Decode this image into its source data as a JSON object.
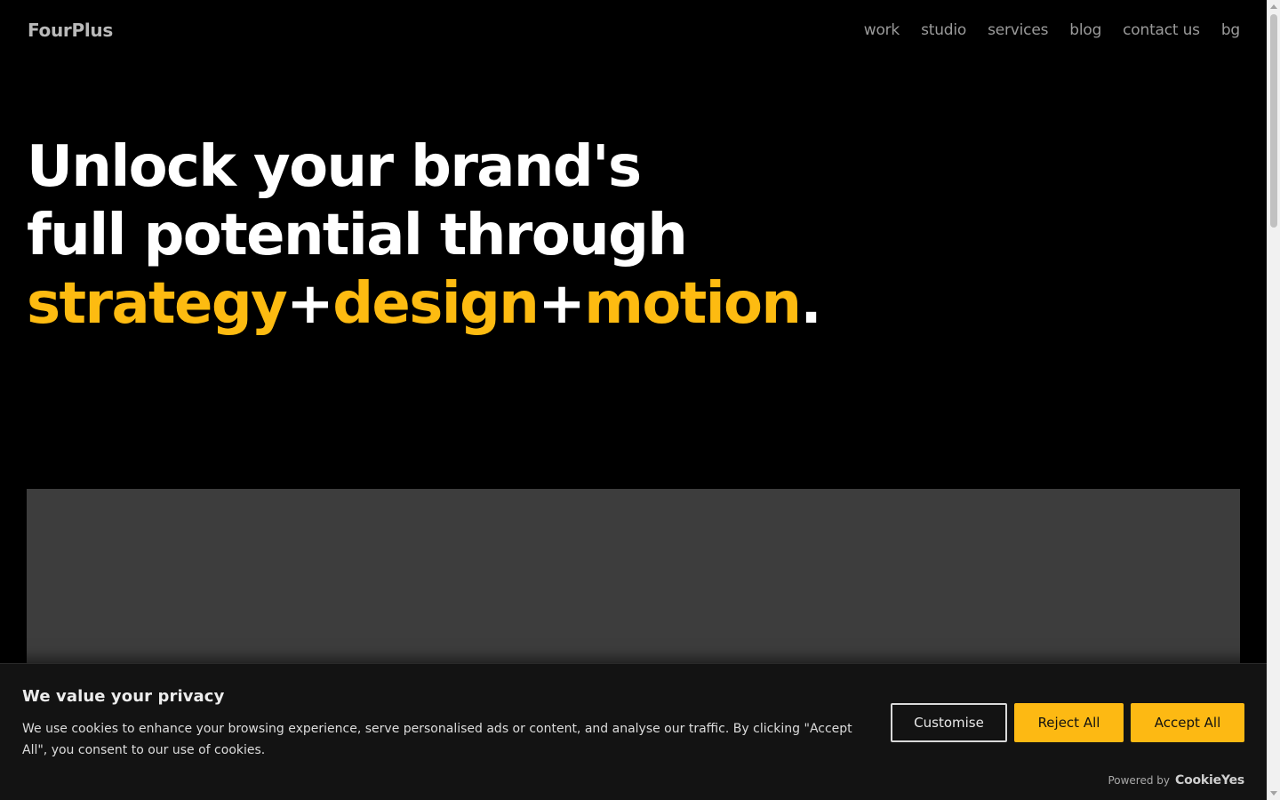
{
  "header": {
    "logo": "FourPlus",
    "nav": [
      {
        "label": "work"
      },
      {
        "label": "studio"
      },
      {
        "label": "services"
      },
      {
        "label": "blog"
      },
      {
        "label": "contact us"
      },
      {
        "label": "bg"
      }
    ]
  },
  "hero": {
    "line1": "Unlock your brand's",
    "line2": "full potential through",
    "word1": "strategy",
    "plus1": "+",
    "word2": "design",
    "plus2": "+",
    "word3": "motion",
    "period": ".",
    "accent_color": "#fdbb11"
  },
  "cookie_banner": {
    "title": "We value your privacy",
    "text": "We use cookies to enhance your browsing experience, serve personalised ads or content, and analyse our traffic. By clicking \"Accept All\", you consent to our use of cookies.",
    "customise_label": "Customise",
    "reject_label": "Reject All",
    "accept_label": "Accept All",
    "powered_by_label": "Powered by",
    "powered_by_brand": "CookieYes",
    "button_color": "#fdb913"
  }
}
